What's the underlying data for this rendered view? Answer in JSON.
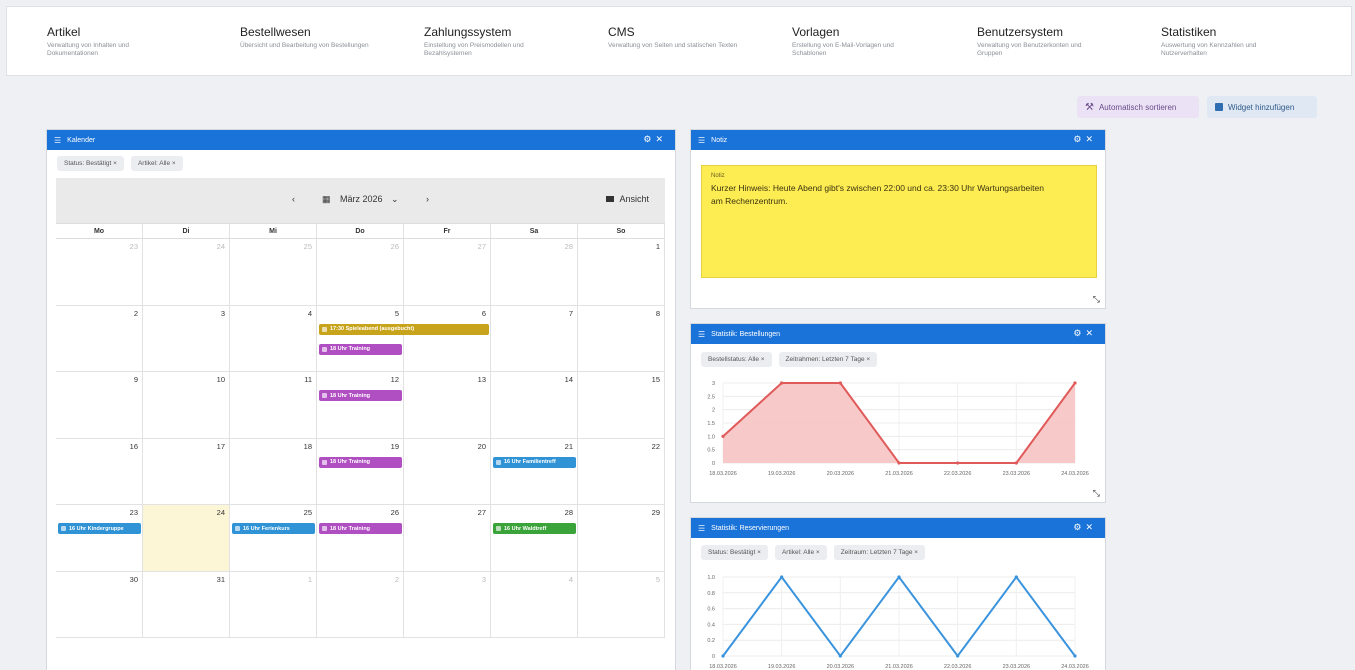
{
  "nav": [
    {
      "title": "Artikel",
      "desc": "Verwaltung von Inhalten und Dokumentationen"
    },
    {
      "title": "Bestellwesen",
      "desc": "Übersicht und Bearbeitung von Bestellungen"
    },
    {
      "title": "Zahlungssystem",
      "desc": "Einstellung von Preismodellen und Bezahlsystemen"
    },
    {
      "title": "CMS",
      "desc": "Verwaltung von Seiten und statischen Texten"
    },
    {
      "title": "Vorlagen",
      "desc": "Erstellung von E-Mail-Vorlagen und Schablonen"
    },
    {
      "title": "Benutzersystem",
      "desc": "Verwaltung von Benutzerkonten und Gruppen"
    },
    {
      "title": "Statistiken",
      "desc": "Auswertung von Kennzahlen und Nutzerverhalten"
    }
  ],
  "toolbar": {
    "auto_label": "Automatisch sortieren",
    "add_label": "Widget hinzufügen"
  },
  "calendar": {
    "title": "Kalender",
    "filters": [
      "Status: Bestätigt ×",
      "Artikel: Alle ×"
    ],
    "month_label": "März 2026",
    "view_label": "Ansicht",
    "weekdays": [
      "Mo",
      "Di",
      "Mi",
      "Do",
      "Fr",
      "Sa",
      "So"
    ],
    "weeks": [
      [
        {
          "n": "23",
          "o": true
        },
        {
          "n": "24",
          "o": true
        },
        {
          "n": "25",
          "o": true
        },
        {
          "n": "26",
          "o": true
        },
        {
          "n": "27",
          "o": true
        },
        {
          "n": "28",
          "o": true
        },
        {
          "n": "1"
        }
      ],
      [
        {
          "n": "2"
        },
        {
          "n": "3"
        },
        {
          "n": "4"
        },
        {
          "n": "5"
        },
        {
          "n": "6"
        },
        {
          "n": "7"
        },
        {
          "n": "8"
        }
      ],
      [
        {
          "n": "9"
        },
        {
          "n": "10"
        },
        {
          "n": "11"
        },
        {
          "n": "12"
        },
        {
          "n": "13"
        },
        {
          "n": "14"
        },
        {
          "n": "15"
        }
      ],
      [
        {
          "n": "16"
        },
        {
          "n": "17"
        },
        {
          "n": "18"
        },
        {
          "n": "19"
        },
        {
          "n": "20"
        },
        {
          "n": "21"
        },
        {
          "n": "22"
        }
      ],
      [
        {
          "n": "23"
        },
        {
          "n": "24",
          "today": true
        },
        {
          "n": "25"
        },
        {
          "n": "26"
        },
        {
          "n": "27"
        },
        {
          "n": "28"
        },
        {
          "n": "29"
        }
      ],
      [
        {
          "n": "30"
        },
        {
          "n": "31"
        },
        {
          "n": "1",
          "o": true
        },
        {
          "n": "2",
          "o": true
        },
        {
          "n": "3",
          "o": true
        },
        {
          "n": "4",
          "o": true
        },
        {
          "n": "5",
          "o": true
        }
      ]
    ],
    "events": [
      {
        "week": 1,
        "day": 3,
        "span": 2,
        "row": 0,
        "label": "17:30 Spieleabend (ausgebucht)",
        "color": "gold"
      },
      {
        "week": 1,
        "day": 3,
        "span": 1,
        "row": 1,
        "label": "18 Uhr Training",
        "color": "purple"
      },
      {
        "week": 2,
        "day": 3,
        "span": 1,
        "row": 0,
        "label": "18 Uhr Training",
        "color": "purple"
      },
      {
        "week": 3,
        "day": 3,
        "span": 1,
        "row": 0,
        "label": "18 Uhr Training",
        "color": "purple"
      },
      {
        "week": 3,
        "day": 5,
        "span": 1,
        "row": 0,
        "label": "16 Uhr Familientreff",
        "color": "blue"
      },
      {
        "week": 4,
        "day": 0,
        "span": 1,
        "row": 0,
        "label": "16 Uhr Kindergruppe",
        "color": "blue"
      },
      {
        "week": 4,
        "day": 2,
        "span": 1,
        "row": 0,
        "label": "16 Uhr Ferienkurs",
        "color": "blue"
      },
      {
        "week": 4,
        "day": 3,
        "span": 1,
        "row": 0,
        "label": "18 Uhr Training",
        "color": "purple"
      },
      {
        "week": 4,
        "day": 5,
        "span": 1,
        "row": 0,
        "label": "16 Uhr Waldtreff",
        "color": "green"
      }
    ]
  },
  "notiz": {
    "title": "Notiz",
    "label": "Notiz",
    "text": "Kurzer Hinweis: Heute Abend gibt's zwischen 22:00 und ca. 23:30 Uhr Wartungsarbeiten am Rechenzentrum."
  },
  "chart1": {
    "title": "Statistik: Bestellungen",
    "filters": [
      "Bestellstatus: Alle ×",
      "Zeitrahmen: Letzten 7 Tage ×"
    ]
  },
  "chart2": {
    "title": "Statistik: Reservierungen",
    "filters": [
      "Status: Bestätigt ×",
      "Artikel: Alle ×",
      "Zeitraum: Letzten 7 Tage ×"
    ]
  },
  "chart_data": [
    {
      "type": "area",
      "x": [
        "18.03.2026",
        "19.03.2026",
        "20.03.2026",
        "21.03.2026",
        "22.03.2026",
        "23.03.2026",
        "24.03.2026"
      ],
      "series": [
        {
          "values": [
            1,
            3,
            3,
            0,
            0,
            0,
            3
          ]
        }
      ],
      "yticks": [
        "3",
        "2.5",
        "2",
        "1.5",
        "1.0",
        "0.5",
        "0"
      ],
      "ylim": [
        0,
        3
      ],
      "grid": true,
      "color": "#e05a5a",
      "fill": "#f7c3c3"
    },
    {
      "type": "line",
      "x": [
        "18.03.2026",
        "19.03.2026",
        "20.03.2026",
        "21.03.2026",
        "22.03.2026",
        "23.03.2026",
        "24.03.2026"
      ],
      "series": [
        {
          "values": [
            0,
            1,
            0,
            1,
            0,
            1,
            0
          ]
        }
      ],
      "yticks": [
        "1.0",
        "0.8",
        "0.6",
        "0.4",
        "0.2",
        "0"
      ],
      "ylim": [
        0,
        1
      ],
      "grid": true,
      "color": "#3a93dd"
    }
  ]
}
